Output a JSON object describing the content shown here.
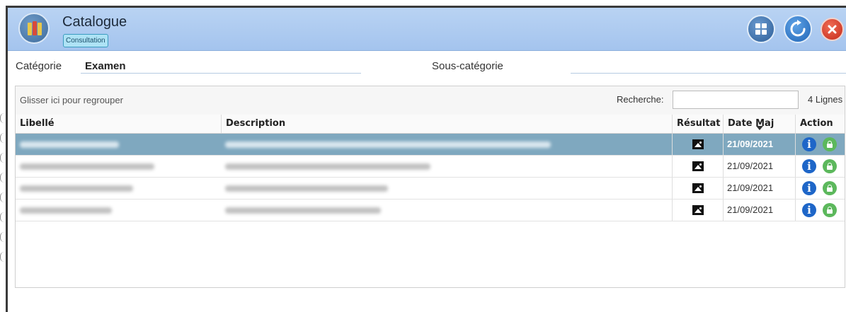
{
  "header": {
    "title": "Catalogue",
    "mode_badge": "Consultation",
    "app_icon": "books-icon",
    "buttons": [
      "grid-icon",
      "refresh-icon",
      "close-icon"
    ]
  },
  "filters": {
    "category_label": "Catégorie",
    "category_value": "Examen",
    "subcategory_label": "Sous-catégorie",
    "subcategory_value": ""
  },
  "grid": {
    "group_hint": "Glisser ici pour regrouper",
    "search_label": "Recherche:",
    "search_value": "",
    "row_count": "4 Lignes",
    "columns": [
      "Libellé",
      "Description",
      "Résultat",
      "Date Maj",
      "Action"
    ],
    "rows": [
      {
        "date": "21/09/2021",
        "selected": true
      },
      {
        "date": "21/09/2021",
        "selected": false
      },
      {
        "date": "21/09/2021",
        "selected": false
      },
      {
        "date": "21/09/2021",
        "selected": false
      }
    ]
  },
  "colors": {
    "header_bg": "#a4c4ee",
    "selected_row": "#7fa8bf",
    "info_blue": "#1e66c8",
    "action_green": "#5cb85c",
    "close_red": "#c4291a"
  }
}
